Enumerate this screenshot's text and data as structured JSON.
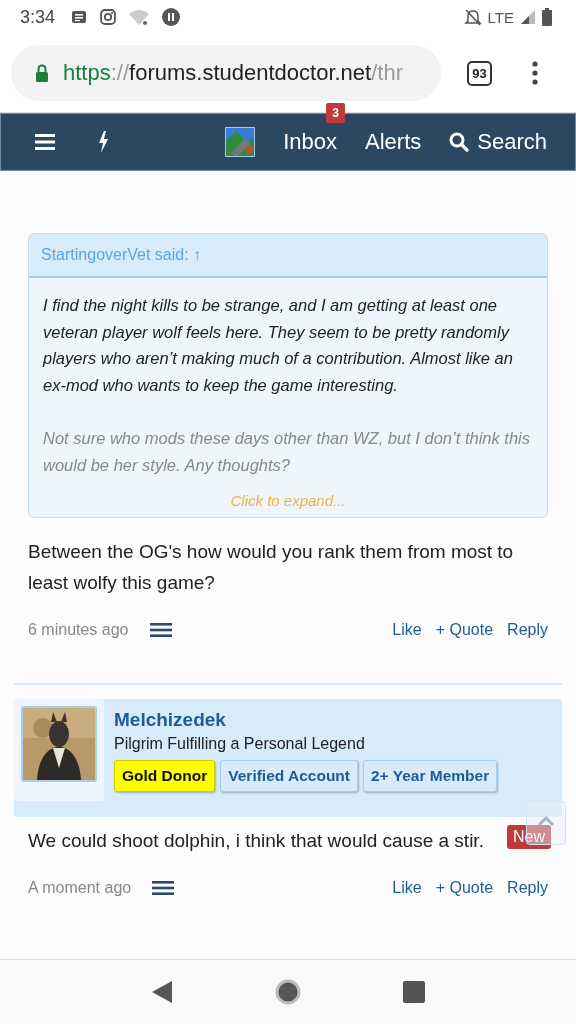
{
  "status_bar": {
    "time": "3:34",
    "network": "LTE"
  },
  "address_bar": {
    "scheme": "https",
    "separator": "://",
    "host": "forums.studentdoctor.net",
    "path": "/thr",
    "tab_count": "93"
  },
  "nav": {
    "items": [
      {
        "kind": "menu"
      },
      {
        "kind": "bolt"
      },
      {
        "kind": "avatar"
      },
      {
        "kind": "link",
        "label": "Inbox",
        "badge": "3"
      },
      {
        "kind": "link",
        "label": "Alerts"
      },
      {
        "kind": "search",
        "label": "Search"
      }
    ]
  },
  "posts": [
    {
      "quote": {
        "author": "StartingoverVet said: ↑",
        "paragraphs": [
          "I find the night kills to be strange, and I am getting at least one veteran player wolf feels here. They seem to be pretty randomly players who aren’t making much of a contribution. Almost like an ex-mod who wants to keep the game interesting.",
          "Not sure who mods these days other than WZ, but I don’t think this would be her style. Any thoughts?"
        ],
        "expand": "Click to expand..."
      },
      "body": "Between the OG's how would you rank them from most to least wolfy this game?",
      "time": "6 minutes ago",
      "actions": [
        "Like",
        "+ Quote",
        "Reply"
      ]
    },
    {
      "user": {
        "name": "Melchizedek",
        "title": "Pilgrim Fulfilling a Personal Legend",
        "banners": [
          {
            "label": "Gold Donor",
            "kind": "gold"
          },
          {
            "label": "Verified Account",
            "kind": "plain"
          },
          {
            "label": "2+ Year Member",
            "kind": "plain"
          }
        ]
      },
      "new_badge": "New",
      "body": "We could shoot dolphin, i think that would cause a stir.",
      "time": "A moment ago",
      "actions": [
        "Like",
        "+ Quote",
        "Reply"
      ]
    }
  ]
}
